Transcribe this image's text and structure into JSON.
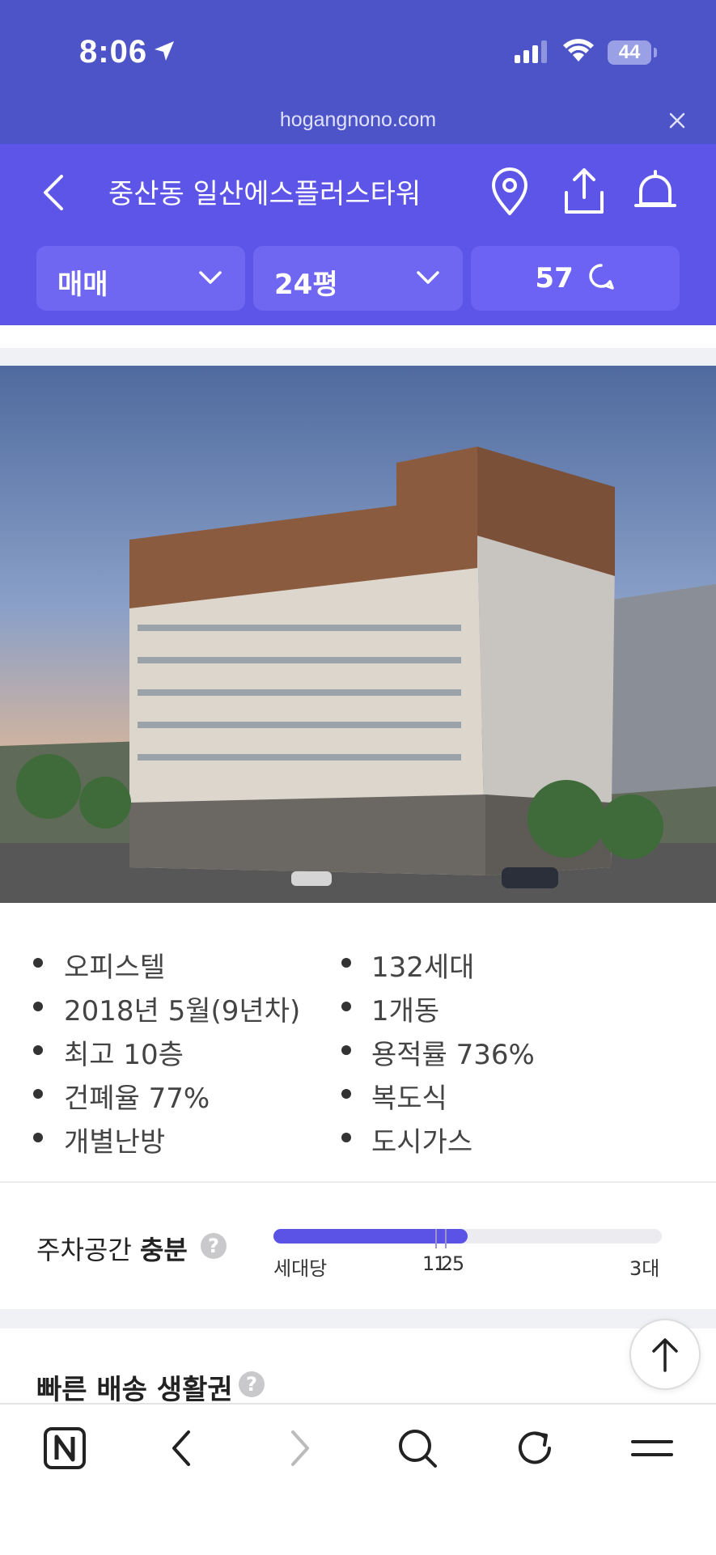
{
  "status_bar": {
    "time": "8:06",
    "battery": "44",
    "icons": [
      "location-arrow-icon",
      "signal-icon",
      "wifi-icon",
      "battery-icon"
    ]
  },
  "browser": {
    "url": "hogangnono.com",
    "close_icon": "close-icon"
  },
  "header": {
    "title": "중산동 일산에스플러스타워",
    "icons": [
      "back-icon",
      "map-pin-icon",
      "share-icon",
      "bell-icon"
    ],
    "filters": {
      "trade_type": "매매",
      "size": "24평",
      "comment_count": "57"
    }
  },
  "building_info": {
    "left": [
      "오피스텔",
      "2018년 5월(9년차)",
      "최고 10층",
      "건폐율 77%",
      "개별난방"
    ],
    "right": [
      "132세대",
      "1개동",
      "용적률 736%",
      "복도식",
      "도시가스"
    ]
  },
  "parking": {
    "label_prefix": "주차공간 ",
    "label_strong": "충분",
    "help": "?",
    "value": 1.5,
    "max": 3,
    "marker": 1.2,
    "axis_start_label": "세대당",
    "marker_label": "1.2",
    "value_label": "1.5",
    "max_label": "3대"
  },
  "delivery": {
    "label": "빠른 배송 생활권",
    "help": "?"
  },
  "bottom_nav": {
    "items": [
      "naver-icon",
      "back-icon",
      "forward-icon",
      "search-icon",
      "refresh-icon",
      "menu-icon"
    ]
  },
  "colors": {
    "status_bar": "#4c54c8",
    "header": "#5d55e8",
    "accent": "#5b52e6"
  }
}
